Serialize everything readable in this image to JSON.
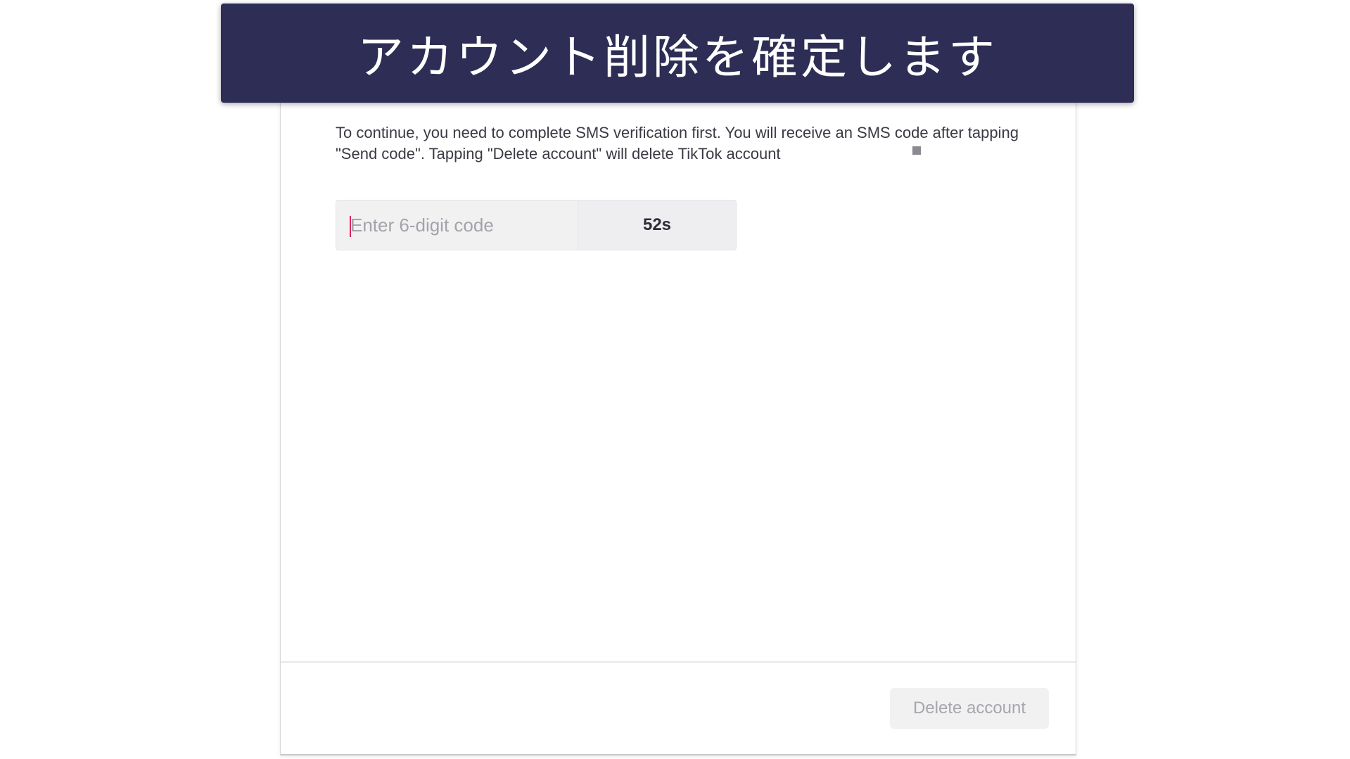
{
  "banner": {
    "title": "アカウント削除を確定します"
  },
  "dialog": {
    "description": "To continue, you need to complete SMS verification first. You will receive an SMS code after tapping \"Send code\". Tapping \"Delete account\" will delete TikTok account",
    "code_input": {
      "value": "",
      "placeholder": "Enter 6-digit code"
    },
    "resend_timer": "52s",
    "delete_button_label": "Delete account"
  }
}
